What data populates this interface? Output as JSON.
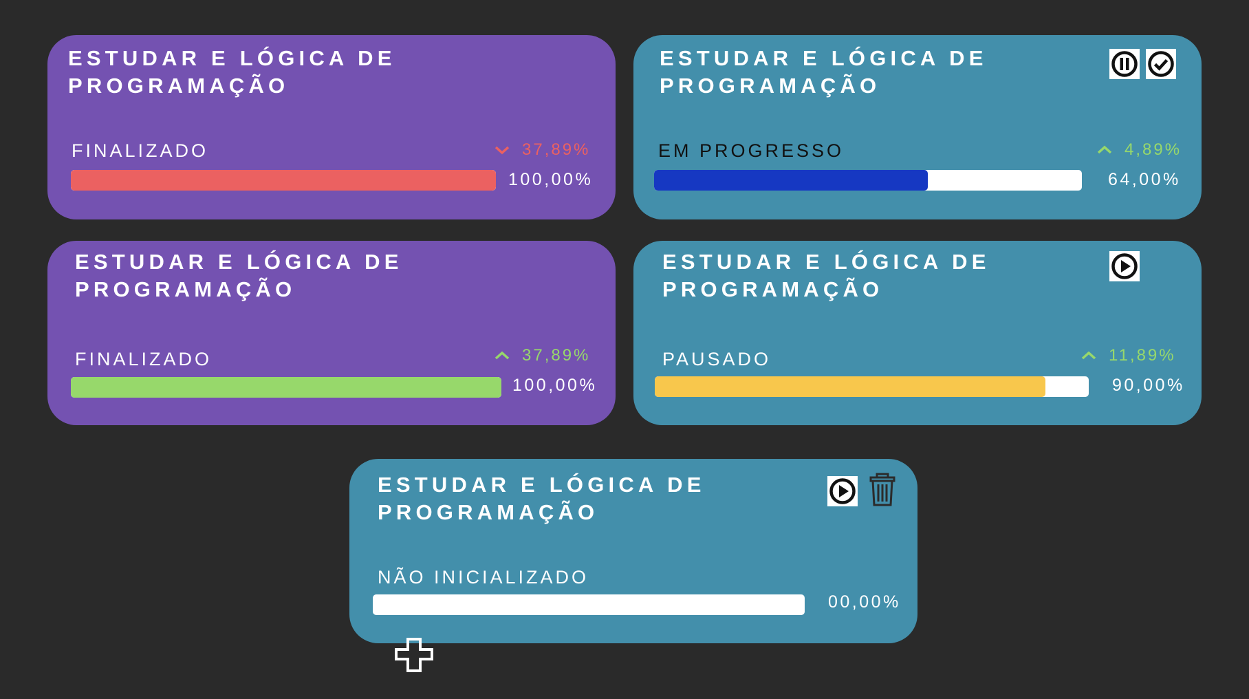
{
  "colors": {
    "background": "#2a2a2a",
    "purple_card": "#7452b1",
    "teal_card": "#438fab",
    "red": "#eb6161",
    "green": "#97d86b",
    "blue": "#1638c2",
    "yellow": "#f8c74c",
    "white": "#ffffff"
  },
  "cards": [
    {
      "title_line1": "ESTUDAR E LÓGICA DE",
      "title_line2": "PROGRAMAÇÃO",
      "status": "FINALIZADO",
      "trend_direction": "down",
      "trend": "37,89%",
      "percent": "100,00%",
      "progress": 1.0,
      "bar_color": "#eb6161",
      "icons": []
    },
    {
      "title_line1": "ESTUDAR E LÓGICA DE",
      "title_line2": "PROGRAMAÇÃO",
      "status": "EM PROGRESSO",
      "trend_direction": "up",
      "trend": "4,89%",
      "percent": "64,00%",
      "progress": 0.64,
      "bar_color": "#1638c2",
      "icons": [
        "pause-icon",
        "check-icon"
      ]
    },
    {
      "title_line1": "ESTUDAR E LÓGICA DE",
      "title_line2": "PROGRAMAÇÃO",
      "status": "FINALIZADO",
      "trend_direction": "up",
      "trend": "37,89%",
      "percent": "100,00%",
      "progress": 1.0,
      "bar_color": "#97d86b",
      "icons": []
    },
    {
      "title_line1": "ESTUDAR E LÓGICA DE",
      "title_line2": "PROGRAMAÇÃO",
      "status": "PAUSADO",
      "trend_direction": "up",
      "trend": "11,89%",
      "percent": "90,00%",
      "progress": 0.9,
      "bar_color": "#f8c74c",
      "icons": [
        "play-icon"
      ]
    },
    {
      "title_line1": "ESTUDAR E LÓGICA DE",
      "title_line2": "PROGRAMAÇÃO",
      "status": "NÃO INICIALIZADO",
      "trend_direction": "none",
      "trend": "",
      "percent": "00,00%",
      "progress": 0.0,
      "bar_color": "#ffffff",
      "icons": [
        "play-icon",
        "trash-icon"
      ]
    }
  ],
  "add_button": {
    "icon": "plus-icon"
  }
}
